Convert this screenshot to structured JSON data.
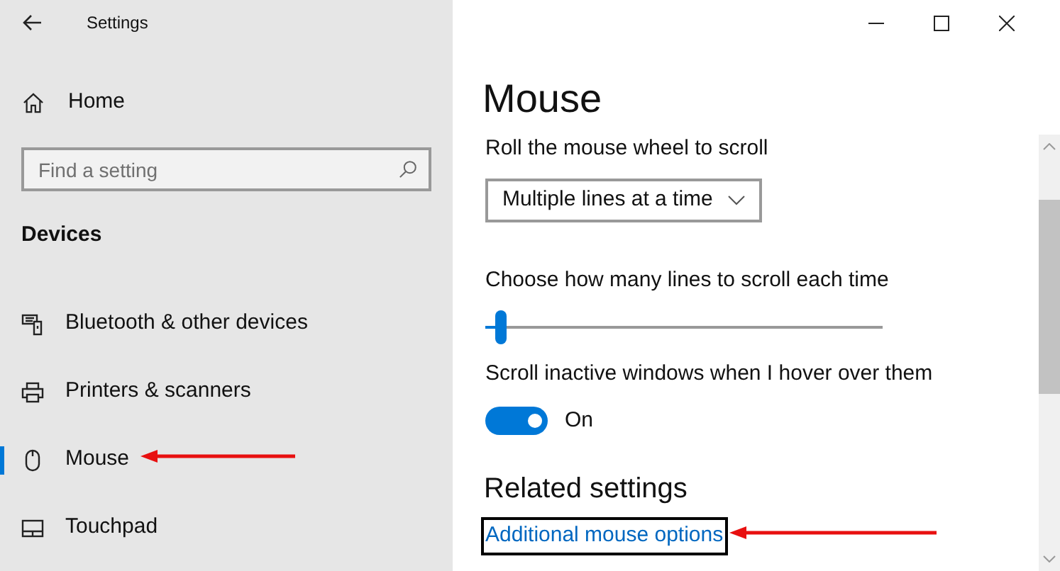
{
  "window": {
    "title": "Settings"
  },
  "sidebar": {
    "home": "Home",
    "search": {
      "placeholder": "Find a setting"
    },
    "section": "Devices",
    "items": [
      {
        "label": "Bluetooth & other devices",
        "kind": "keyboard",
        "selected": false
      },
      {
        "label": "Printers & scanners",
        "kind": "printer",
        "selected": false
      },
      {
        "label": "Mouse",
        "kind": "mouse",
        "selected": true
      },
      {
        "label": "Touchpad",
        "kind": "touchpad",
        "selected": false
      }
    ]
  },
  "page": {
    "title": "Mouse",
    "wheel": {
      "label": "Roll the mouse wheel to scroll",
      "value": "Multiple lines at a time"
    },
    "lines": {
      "label": "Choose how many lines to scroll each time",
      "level": 0.03
    },
    "inactive": {
      "label": "Scroll inactive windows when I hover over them",
      "on": true,
      "state_text": "On"
    },
    "related": {
      "title": "Related settings",
      "link": "Additional mouse options"
    }
  }
}
